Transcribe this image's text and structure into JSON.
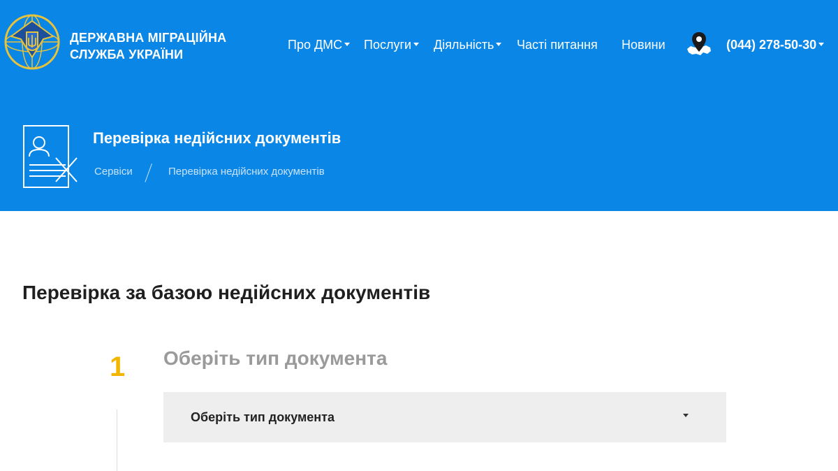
{
  "header": {
    "org_name_line1": "ДЕРЖАВНА МІГРАЦІЙНА",
    "org_name_line2": "СЛУЖБА УКРАЇНИ",
    "nav": [
      {
        "label": "Про ДМС",
        "dropdown": true
      },
      {
        "label": "Послуги",
        "dropdown": true
      },
      {
        "label": "Діяльність",
        "dropdown": true
      },
      {
        "label": "Часті питання",
        "dropdown": false
      },
      {
        "label": "Новини",
        "dropdown": false
      }
    ],
    "phone": "(044) 278-50-30",
    "icons": {
      "logo": "dms-emblem-icon",
      "map": "ukraine-map-pin-icon",
      "page": "invalid-document-icon"
    },
    "colors": {
      "header_bg": "#0a86e6",
      "accent": "#f2b600"
    }
  },
  "page": {
    "title": "Перевірка недійсних документів",
    "breadcrumb": [
      "Сервіси",
      "Перевірка недійсних документів"
    ]
  },
  "main": {
    "section_title": "Перевірка за базою недійсних документів",
    "step": {
      "number": "1",
      "title": "Оберіть тип документа",
      "select_value": "Оберіть тип документа"
    }
  }
}
